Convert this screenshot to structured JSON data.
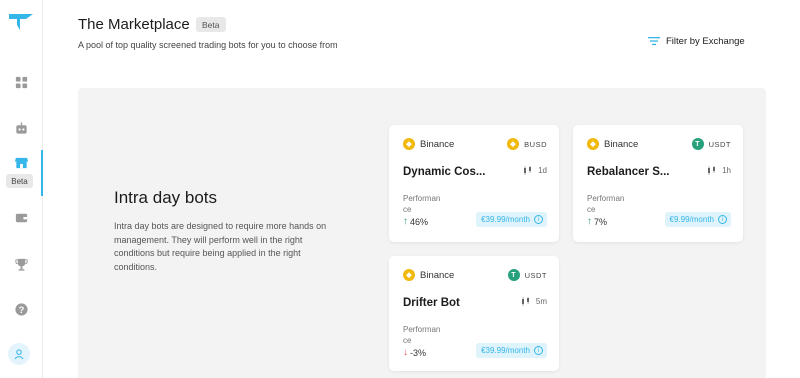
{
  "header": {
    "title": "The Marketplace",
    "title_badge": "Beta",
    "subtitle": "A pool of top quality screened trading bots for you to choose from",
    "filter_label": "Filter by Exchange"
  },
  "sidebar": {
    "items": [
      {
        "name": "dashboard",
        "icon": "grid-icon"
      },
      {
        "name": "bots",
        "icon": "robot-icon"
      },
      {
        "name": "marketplace",
        "icon": "store-icon",
        "badge": "Beta",
        "active": true
      },
      {
        "name": "wallet",
        "icon": "wallet-icon"
      },
      {
        "name": "leaderboard",
        "icon": "trophy-icon"
      },
      {
        "name": "help",
        "icon": "question-icon"
      }
    ],
    "accent_color": "#35b6e8"
  },
  "section": {
    "title": "Intra day bots",
    "description": "Intra day bots are designed to require more hands on management. They will perform well in the right conditions but require being applied in the right conditions."
  },
  "cards": [
    {
      "exchange": "Binance",
      "quote": "BUSD",
      "name": "Dynamic Cos...",
      "interval": "1d",
      "perf_label": "Performance",
      "perf_value": "46%",
      "trend": "up",
      "price": "€39.99/month"
    },
    {
      "exchange": "Binance",
      "quote": "USDT",
      "name": "Rebalancer S...",
      "interval": "1h",
      "perf_label": "Performance",
      "perf_value": "7%",
      "trend": "up",
      "price": "€9.99/month"
    },
    {
      "exchange": "Binance",
      "quote": "USDT",
      "name": "Drifter Bot",
      "interval": "5m",
      "perf_label": "Performance",
      "perf_value": "-3%",
      "trend": "down",
      "price": "€39.99/month"
    }
  ]
}
